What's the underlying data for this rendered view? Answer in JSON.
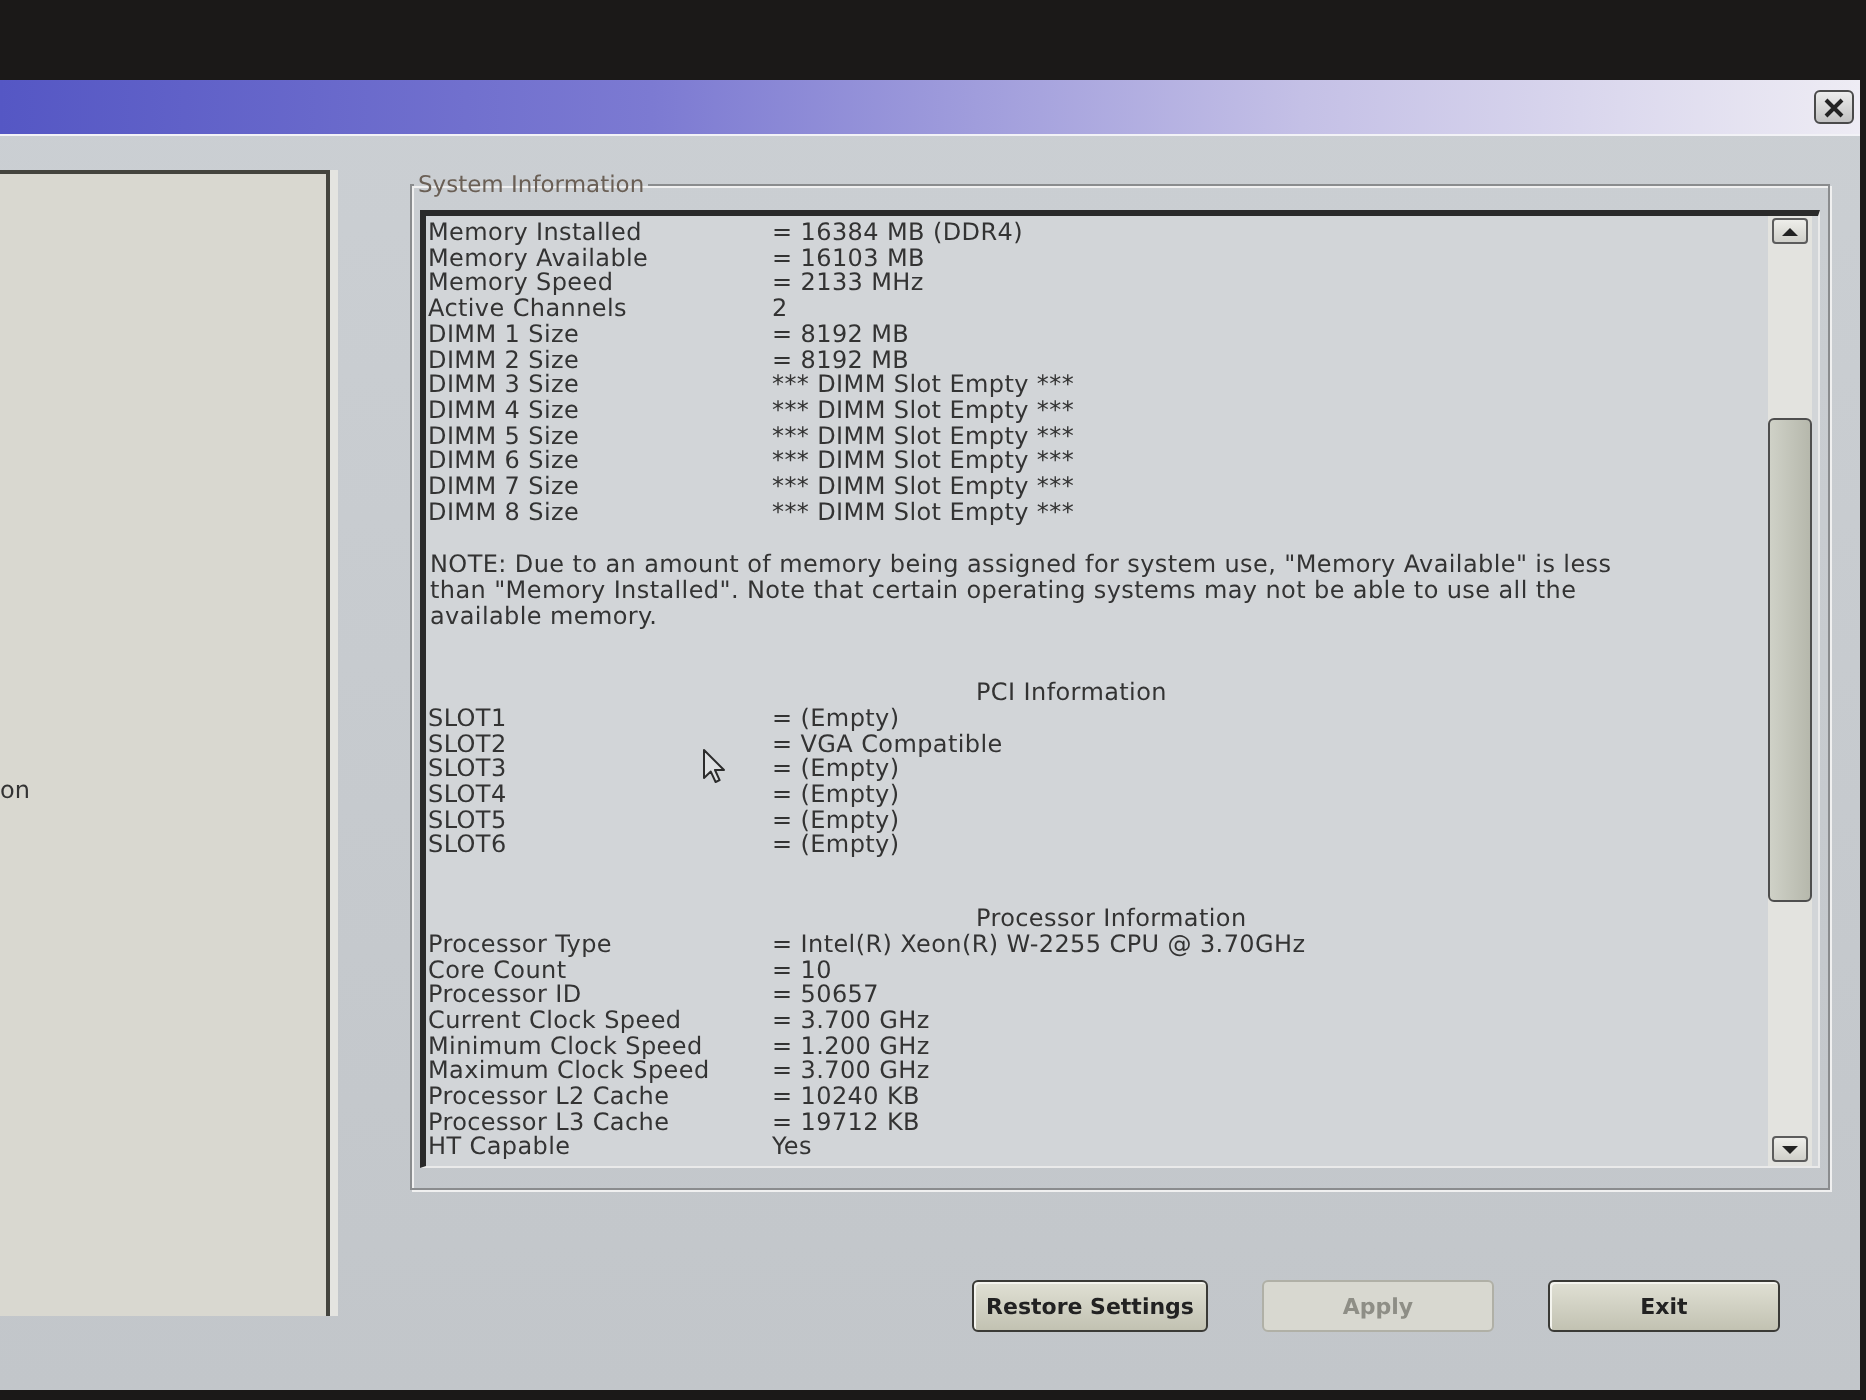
{
  "sidebar": {
    "items": [
      {
        "label": "on"
      }
    ]
  },
  "system_information": {
    "title": "System Information",
    "memory_rows": [
      {
        "label": "Memory Installed",
        "value": "= 16384 MB (DDR4)"
      },
      {
        "label": "Memory Available",
        "value": "= 16103 MB"
      },
      {
        "label": "Memory Speed",
        "value": "= 2133 MHz"
      },
      {
        "label": "Active Channels",
        "value": "2"
      },
      {
        "label": "DIMM 1 Size",
        "value": "= 8192 MB"
      },
      {
        "label": "DIMM 2 Size",
        "value": "= 8192 MB"
      },
      {
        "label": "DIMM 3 Size",
        "value": "*** DIMM Slot Empty ***"
      },
      {
        "label": "DIMM 4 Size",
        "value": "*** DIMM Slot Empty ***"
      },
      {
        "label": "DIMM 5 Size",
        "value": "*** DIMM Slot Empty ***"
      },
      {
        "label": "DIMM 6 Size",
        "value": "*** DIMM Slot Empty ***"
      },
      {
        "label": "DIMM 7 Size",
        "value": "*** DIMM Slot Empty ***"
      },
      {
        "label": "DIMM 8 Size",
        "value": "*** DIMM Slot Empty ***"
      }
    ],
    "note": "NOTE: Due to an amount of memory being assigned for system use, \"Memory Available\" is less than \"Memory Installed\". Note that certain operating systems may not be able to use all the available memory.",
    "sections": [
      {
        "heading": "PCI Information",
        "rows": [
          {
            "label": "SLOT1",
            "value": "= (Empty)"
          },
          {
            "label": "SLOT2",
            "value": "= VGA Compatible"
          },
          {
            "label": "SLOT3",
            "value": "= (Empty)"
          },
          {
            "label": "SLOT4",
            "value": "= (Empty)"
          },
          {
            "label": "SLOT5",
            "value": "= (Empty)"
          },
          {
            "label": "SLOT6",
            "value": "= (Empty)"
          }
        ]
      },
      {
        "heading": "Processor Information",
        "rows": [
          {
            "label": "Processor Type",
            "value": "= Intel(R) Xeon(R) W-2255 CPU @ 3.70GHz"
          },
          {
            "label": "Core Count",
            "value": "= 10"
          },
          {
            "label": "Processor ID",
            "value": "= 50657"
          },
          {
            "label": "Current Clock Speed",
            "value": "= 3.700 GHz"
          },
          {
            "label": "Minimum Clock Speed",
            "value": "= 1.200 GHz"
          },
          {
            "label": "Maximum Clock Speed",
            "value": "= 3.700 GHz"
          },
          {
            "label": "Processor L2 Cache",
            "value": "= 10240 KB"
          },
          {
            "label": "Processor L3 Cache",
            "value": "= 19712 KB"
          },
          {
            "label": "HT Capable",
            "value": "Yes"
          }
        ]
      }
    ]
  },
  "buttons": [
    {
      "label": "Restore Settings",
      "disabled": false
    },
    {
      "label": "Apply",
      "disabled": true
    },
    {
      "label": "Exit",
      "disabled": false
    }
  ]
}
